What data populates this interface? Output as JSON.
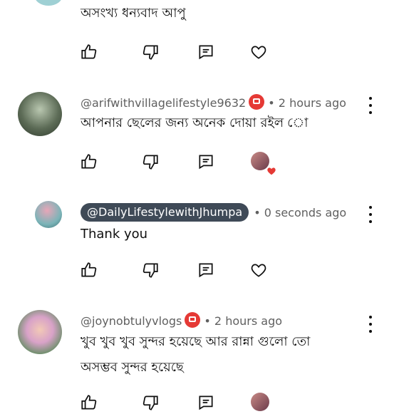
{
  "comments": [
    {
      "text": "অসংখ্য ধন্যবাদ আপু"
    },
    {
      "handle": "@arifwithvillagelifestyle9632",
      "time": "• 2 hours ago",
      "text": "আপনার ছেলের জন্য অনেক দোয়া রইল ো"
    },
    {
      "handle": "@DailyLifestylewithJhumpa",
      "time": "• 0 seconds ago",
      "text": "Thank you"
    },
    {
      "handle": "@joynobtulyvlogs",
      "time": "• 2 hours ago",
      "text_line1": "খুব খুব খুব সুন্দর হয়েছে আর রান্না গুলো তো",
      "text_line2": "অসম্ভব সুন্দর হয়েছে"
    }
  ],
  "icons": {
    "like": "thumbs-up-icon",
    "dislike": "thumbs-down-icon",
    "reply": "reply-icon",
    "heart": "heart-icon",
    "more": "more-vert-icon",
    "membership": "membership-badge-icon"
  }
}
